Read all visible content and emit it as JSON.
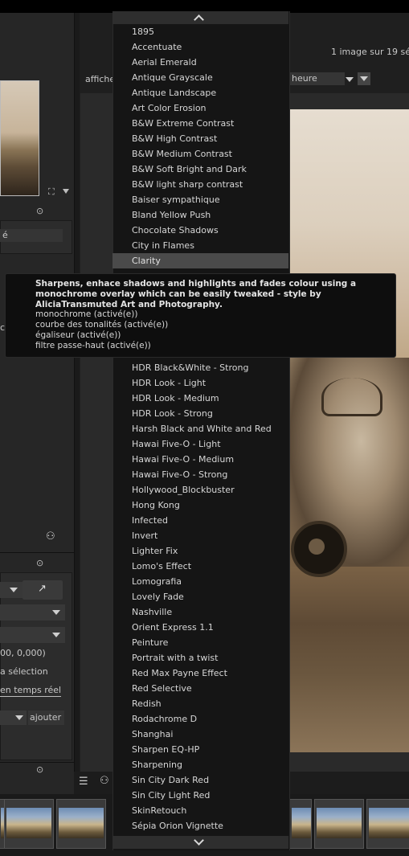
{
  "header": {
    "image_count": "1 image sur 19 sé",
    "show_label": "affiche",
    "sort_field": "heure"
  },
  "left_panel": {
    "field1": "é",
    "item_c": "c",
    "coords": "00, 0,000)",
    "selection_label": "a sélection",
    "realtime_label": "en temps réel",
    "add_button": "ajouter"
  },
  "dropdown": {
    "items_top": [
      "1895",
      "Accentuate",
      "Aerial Emerald",
      "Antique Grayscale",
      "Antique Landscape",
      "Art Color Erosion",
      "B&W Extreme Contrast",
      "B&W High Contrast",
      "B&W Medium Contrast",
      "B&W Soft Bright and Dark",
      "B&W light sharp contrast",
      "Baiser sympathique",
      "Bland Yellow Push",
      "Chocolate Shadows",
      "City in Flames",
      "Clarity"
    ],
    "items_bottom": [
      "HDR Black&White - Strong",
      "HDR Look - Light",
      "HDR Look - Medium",
      "HDR Look - Strong",
      "Harsh Black and White and Red",
      "Hawai Five-O - Light",
      "Hawai Five-O - Medium",
      "Hawai Five-O - Strong",
      "Hollywood_Blockbuster",
      "Hong Kong",
      "Infected",
      "Invert",
      "Lighter Fix",
      "Lomo's Effect",
      "Lomografia",
      "Lovely Fade",
      "Nashville",
      "Orient Express 1.1",
      "Peinture",
      "Portrait with a twist",
      "Red Max Payne Effect",
      "Red Selective",
      "Redish",
      "Rodachrome D",
      "Shanghai",
      "Sharpen EQ-HP",
      "Sharpening",
      "Sin City Dark Red",
      "Sin City Light Red",
      "SkinRetouch",
      "Sépia Orion Vignette"
    ]
  },
  "tooltip": {
    "line1": "Sharpens, enhace shadows and highlights and fades colour using a",
    "line2": "monochrome overlay which can be easily tweaked - style by",
    "line3": "AliciaTransmuted Art and Photography.",
    "module1": "monochrome (activé(e))",
    "module2": "courbe des tonalités (activé(e))",
    "module3": "égaliseur (activé(e))",
    "module4": "filtre passe-haut (activé(e))"
  },
  "icons": [
    "chevron-up-icon",
    "chevron-down-icon",
    "dropdown-arrow-icon",
    "sort-order-icon",
    "expand-icon",
    "collapse-icon",
    "presets-icon",
    "pipette-icon",
    "menu-icon"
  ]
}
